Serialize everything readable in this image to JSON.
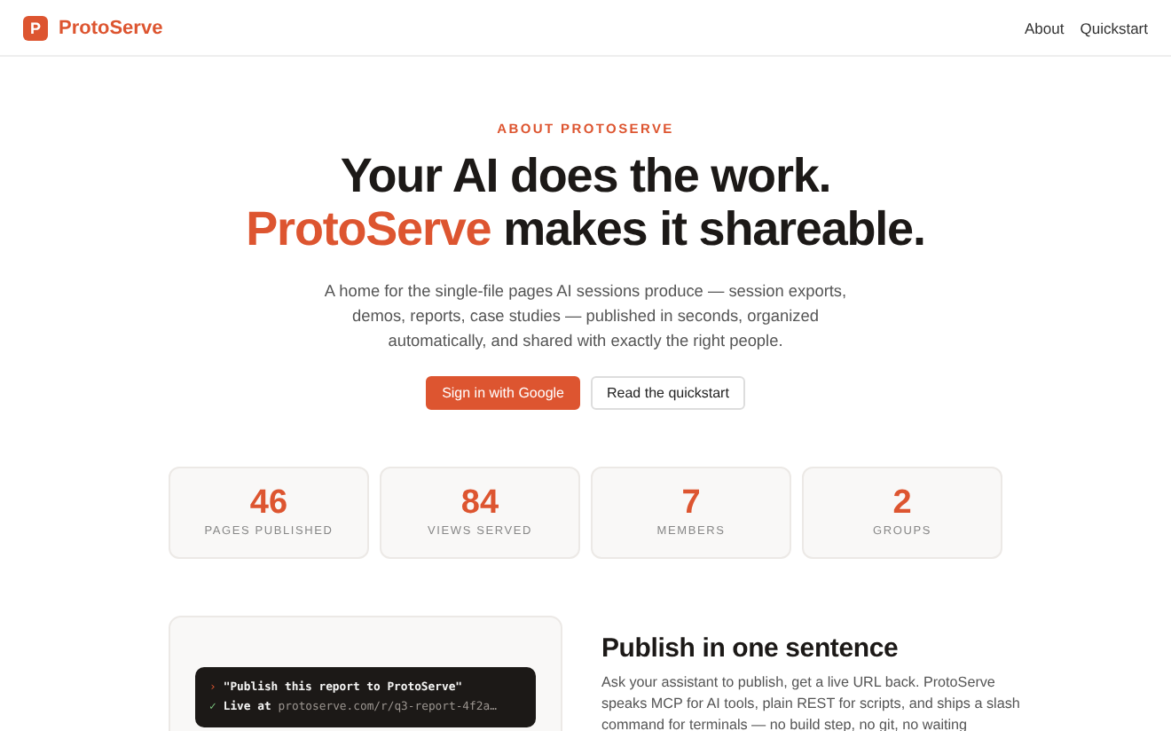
{
  "header": {
    "brand": {
      "icon_letter": "P",
      "name": "ProtoServe"
    },
    "nav": [
      "About",
      "Quickstart"
    ]
  },
  "hero": {
    "eyebrow": "ABOUT PROTOSERVE",
    "headline_line_1": "Your AI does the work.",
    "headline_accent": "ProtoServe",
    "headline_rest": "makes it shareable.",
    "description": "A home for the single-file pages AI sessions produce — session exports, demos, reports, case studies — published in seconds, organized automatically, and shared with exactly the right people.",
    "buttons": [
      {
        "label": "Sign in with Google",
        "kind": "primary"
      },
      {
        "label": "Read the quickstart",
        "kind": "secondary"
      }
    ]
  },
  "stats": [
    {
      "value": "46",
      "label": "PAGES PUBLISHED"
    },
    {
      "value": "84",
      "label": "VIEWS SERVED"
    },
    {
      "value": "7",
      "label": "MEMBERS"
    },
    {
      "value": "2",
      "label": "GROUPS"
    }
  ],
  "feature": {
    "terminal": [
      {
        "marker": "›",
        "kind": "prompt",
        "text": "\"Publish this report to ProtoServe\""
      },
      {
        "marker": "✓",
        "kind": "result",
        "text": "Live at",
        "link": "protoserve.com/r/q3-report-4f2a…"
      }
    ],
    "title": "Publish in one sentence",
    "body": "Ask your assistant to publish, get a live URL back. ProtoServe speaks MCP for AI tools, plain REST for scripts, and ships a slash command for terminals — no build step, no git, no waiting"
  }
}
